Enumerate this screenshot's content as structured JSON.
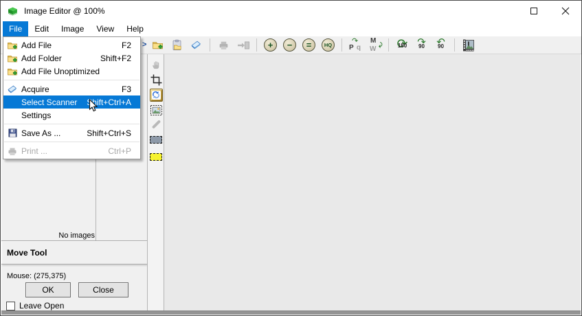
{
  "window": {
    "title": "Image Editor @ 100%"
  },
  "menubar": {
    "items": [
      {
        "label": "File",
        "active": true
      },
      {
        "label": "Edit",
        "active": false
      },
      {
        "label": "Image",
        "active": false
      },
      {
        "label": "View",
        "active": false
      },
      {
        "label": "Help",
        "active": false
      }
    ]
  },
  "file_menu": {
    "items": [
      {
        "label": "Add File",
        "shortcut": "F2",
        "icon": "add-file-icon",
        "state": "normal"
      },
      {
        "label": "Add Folder",
        "shortcut": "Shift+F2",
        "icon": "add-folder-icon",
        "state": "normal"
      },
      {
        "label": "Add File Unoptimized",
        "shortcut": "",
        "icon": "add-file-icon",
        "state": "normal"
      },
      {
        "label": "Acquire",
        "shortcut": "F3",
        "icon": "scanner-icon",
        "state": "normal"
      },
      {
        "label": "Select Scanner",
        "shortcut": "Shift+Ctrl+A",
        "icon": "none",
        "state": "selected"
      },
      {
        "label": "Settings",
        "shortcut": "",
        "icon": "none",
        "state": "normal"
      },
      {
        "label": "Save As ...",
        "shortcut": "Shift+Ctrl+S",
        "icon": "save-icon",
        "state": "normal"
      },
      {
        "label": "Print ...",
        "shortcut": "Ctrl+P",
        "icon": "printer-icon",
        "state": "disabled"
      }
    ]
  },
  "toolbar": {
    "overflow_chevron": ">",
    "button_icons": [
      "add-file-icon",
      "paste-icon",
      "acquire-scanner-icon",
      "print-icon",
      "send-to-icon",
      "zoom-in-icon",
      "zoom-out-icon",
      "zoom-actual-icon",
      "zoom-hq-icon",
      "flip-horizontal-icon",
      "flip-vertical-icon",
      "rotate-180-icon",
      "rotate-90-cw-icon",
      "rotate-90-ccw-icon",
      "thumbnails-icon"
    ],
    "glyphs": {
      "zoom_in": "+",
      "zoom_out": "−",
      "zoom_actual": "=",
      "zoom_hq": "HQ",
      "flip_h_a": "P",
      "flip_h_b": "q",
      "flip_v_a": "M",
      "flip_v_b": "W",
      "rotate_180": "180",
      "rotate_90_cw": "90",
      "rotate_90_ccw": "90"
    }
  },
  "tool_palette": {
    "icons": [
      "pan-hand-icon",
      "crop-icon",
      "move-tool-icon",
      "select-image-icon",
      "marker-icon",
      "gray-rectangle-icon",
      "yellow-rectangle-icon"
    ],
    "active_tool": "move-tool"
  },
  "left_panel": {
    "empty_text": "No images",
    "tool_title": "Move Tool",
    "mouse_status": "Mouse: (275,375)",
    "ok_label": "OK",
    "close_label": "Close",
    "leave_open_label": "Leave Open",
    "leave_open_checked": false
  },
  "colors": {
    "accent": "#0679d6",
    "toolbar_bg": "#f0f0f0",
    "canvas_bg": "#e9e9e9",
    "icon_green": "#2d7a2d",
    "disabled_text": "#a8a8a8"
  }
}
